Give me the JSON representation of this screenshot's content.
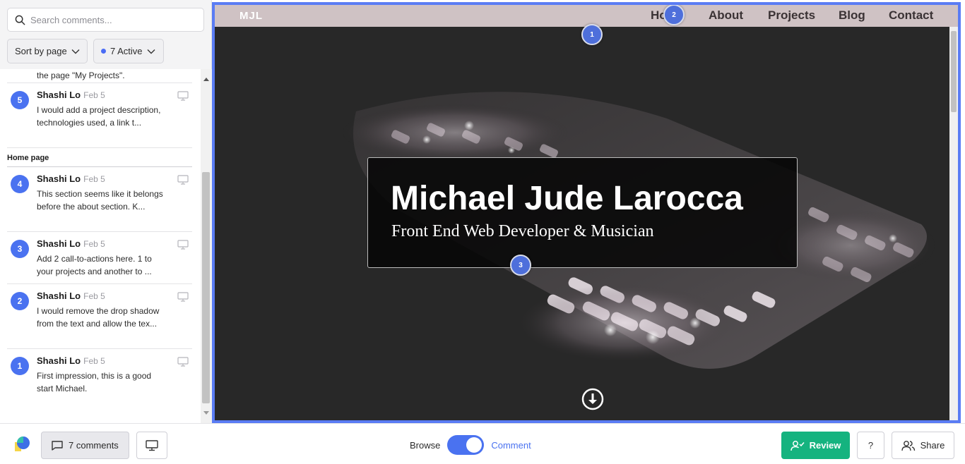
{
  "sidebar": {
    "search_placeholder": "Search comments...",
    "sort_label": "Sort by page",
    "active_label": "7 Active",
    "partial_comment": "I would remove this and just name the page \"My Projects\".",
    "comments_top": [
      {
        "number": "5",
        "author": "Shashi Lo",
        "date": "Feb 5",
        "text": "I would add a project description, technologies used, a link t..."
      }
    ],
    "section_title": "Home page",
    "comments": [
      {
        "number": "4",
        "author": "Shashi Lo",
        "date": "Feb 5",
        "text": "This section seems like it belongs before the about section. K..."
      },
      {
        "number": "3",
        "author": "Shashi Lo",
        "date": "Feb 5",
        "text": "Add 2 call-to-actions here. 1 to your projects and another to ..."
      },
      {
        "number": "2",
        "author": "Shashi Lo",
        "date": "Feb 5",
        "text": "I would remove the drop shadow from the text and allow the tex..."
      },
      {
        "number": "1",
        "author": "Shashi Lo",
        "date": "Feb 5",
        "text": "First impression, this is a good start Michael."
      }
    ]
  },
  "preview": {
    "logo": "MJL",
    "nav": [
      "Home",
      "About",
      "Projects",
      "Blog",
      "Contact"
    ],
    "hero_title": "Michael Jude Larocca",
    "hero_subtitle": "Front End Web Developer & Musician",
    "pins": [
      "1",
      "2",
      "3"
    ],
    "down_icon": "arrow-down-circle-icon"
  },
  "bottombar": {
    "comments_label": "7 comments",
    "browse_label": "Browse",
    "comment_label": "Comment",
    "mode": "Comment",
    "review_label": "Review",
    "help_label": "?",
    "share_label": "Share"
  },
  "colors": {
    "accent": "#4a72f0",
    "review_green": "#15b37f",
    "frame_border": "#5a7cf4",
    "nav_bg": "#cfc2c4"
  }
}
